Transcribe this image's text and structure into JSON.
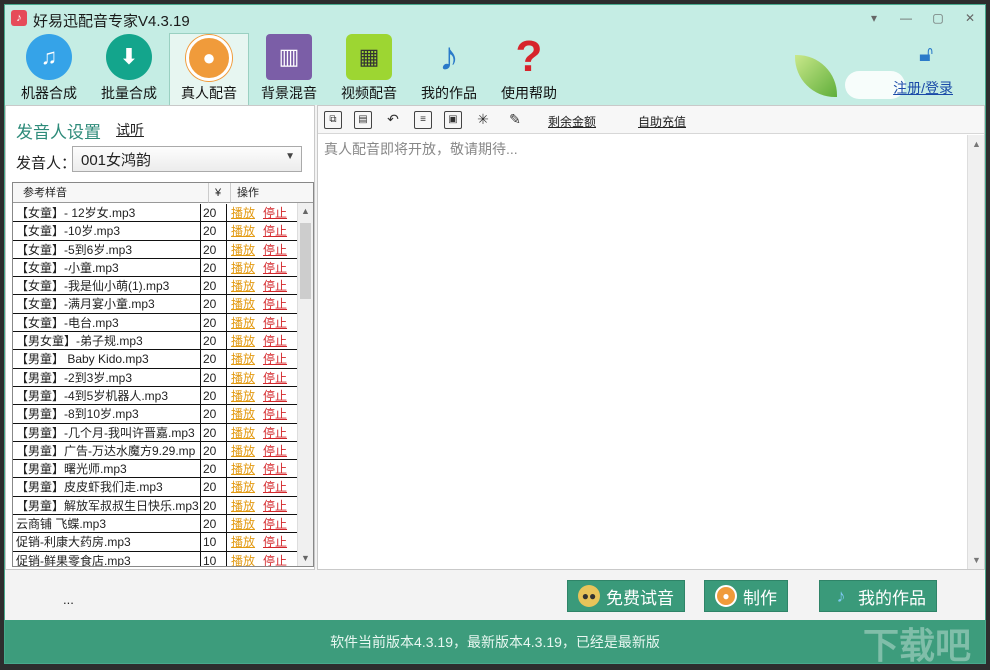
{
  "app": {
    "title": "好易迅配音专家V4.3.19",
    "icon": "music-note-icon"
  },
  "window_controls": [
    "▾",
    "—",
    "▢",
    "✕"
  ],
  "toolbar": [
    {
      "label": "机器合成",
      "icon": "music-note-icon",
      "active": false
    },
    {
      "label": "批量合成",
      "icon": "mp3-download-icon",
      "active": false
    },
    {
      "label": "真人配音",
      "icon": "person-icon",
      "active": true
    },
    {
      "label": "背景混音",
      "icon": "equalizer-icon",
      "active": false
    },
    {
      "label": "视频配音",
      "icon": "film-icon",
      "active": false
    },
    {
      "label": "我的作品",
      "icon": "music-note-3d-icon",
      "active": false
    },
    {
      "label": "使用帮助",
      "icon": "question-mark-icon",
      "active": false
    }
  ],
  "header": {
    "register_login": "注册/登录"
  },
  "left_panel": {
    "title": "发音人设置",
    "audition_link": "试听",
    "speaker_label": "发音人：",
    "speaker_value": "001女鸿韵",
    "table": {
      "headers": [
        "参考样音",
        "¥",
        "操作"
      ],
      "play_label": "播放",
      "stop_label": "停止",
      "rows": [
        {
          "name": "【女童】- 12岁女.mp3",
          "price": "20"
        },
        {
          "name": "【女童】-10岁.mp3",
          "price": "20"
        },
        {
          "name": "【女童】-5到6岁.mp3",
          "price": "20"
        },
        {
          "name": "【女童】-小童.mp3",
          "price": "20"
        },
        {
          "name": "【女童】-我是仙小萌(1).mp3",
          "price": "20"
        },
        {
          "name": "【女童】-满月宴小童.mp3",
          "price": "20"
        },
        {
          "name": "【女童】-电台.mp3",
          "price": "20"
        },
        {
          "name": "【男女童】-弟子规.mp3",
          "price": "20"
        },
        {
          "name": "【男童】 Baby Kido.mp3",
          "price": "20"
        },
        {
          "name": "【男童】-2到3岁.mp3",
          "price": "20"
        },
        {
          "name": "【男童】-4到5岁机器人.mp3",
          "price": "20"
        },
        {
          "name": "【男童】-8到10岁.mp3",
          "price": "20"
        },
        {
          "name": "【男童】-几个月-我叫许晋嘉.mp3",
          "price": "20"
        },
        {
          "name": "【男童】广告-万达水魔方9.29.mp",
          "price": "20"
        },
        {
          "name": "【男童】曙光师.mp3",
          "price": "20"
        },
        {
          "name": "【男童】皮皮虾我们走.mp3",
          "price": "20"
        },
        {
          "name": "【男童】解放军叔叔生日快乐.mp3",
          "price": "20"
        },
        {
          "name": "云商铺 飞蝶.mp3",
          "price": "20"
        },
        {
          "name": "促销-利康大药房.mp3",
          "price": "10"
        },
        {
          "name": "促销-鲜果零食店.mp3",
          "price": "10"
        }
      ]
    }
  },
  "right_panel": {
    "toolbar_icons": [
      "copy-icon",
      "paste-icon",
      "undo-icon",
      "document-icon",
      "save-icon",
      "sparkle-icon",
      "brush-icon"
    ],
    "balance_link": "剩余金额",
    "recharge_link": "自助充值",
    "editor_text": "真人配音即将开放，敬请期待..."
  },
  "bottom": {
    "ellipsis": "...",
    "free_trial_button": "免费试音",
    "make_button": "制作",
    "my_works_button": "我的作品"
  },
  "status_bar": {
    "text": "软件当前版本4.3.19，最新版本4.3.19，已经是最新版"
  },
  "watermark": "下载吧"
}
